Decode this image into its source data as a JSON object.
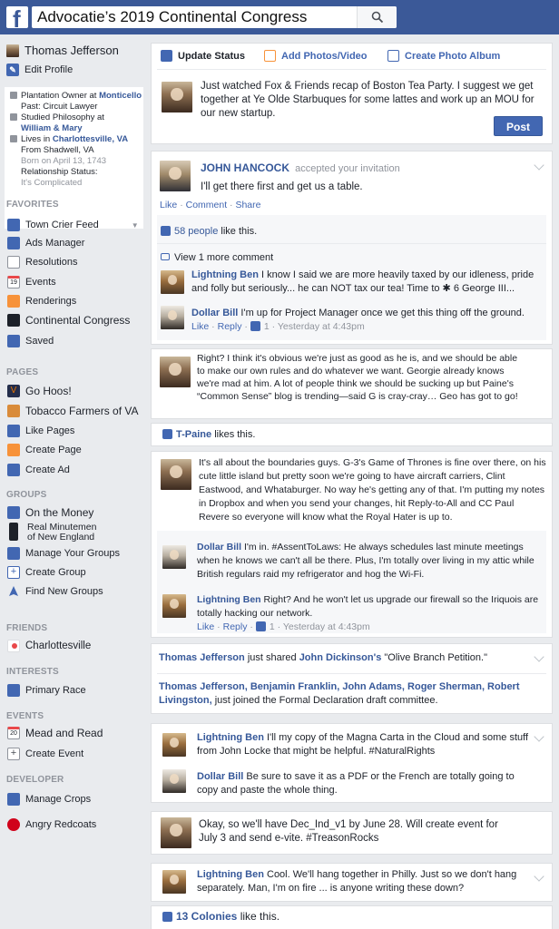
{
  "search": {
    "query": "Advocatie’s 2019 Continental Congress"
  },
  "profile": {
    "name": "Thomas Jefferson",
    "edit": "Edit Profile",
    "info": {
      "job": "Plantation Owner at",
      "job_place": "Monticello",
      "past": "Past: Circuit Lawyer",
      "studied": "Studied Philosophy at",
      "school": "William & Mary",
      "lives": "Lives in",
      "city": "Charlottesville, VA",
      "from": "From Shadwell, VA",
      "born": "Born on April 13, 1743",
      "rel": "Relationship Status:",
      "rel_val": "It's Complicated"
    }
  },
  "favorites": {
    "header": "FAVORITES",
    "items": [
      "Town Crier Feed",
      "Ads Manager",
      "Resolutions",
      "Events",
      "Renderings",
      "Continental Congress",
      "Saved"
    ],
    "events_day": "19"
  },
  "pages": {
    "header": "PAGES",
    "items": [
      "Go Hoos!",
      "Tobacco Farmers of VA",
      "Like Pages",
      "Create Page",
      "Create Ad"
    ]
  },
  "groups": {
    "header": "GROUPS",
    "items": [
      "On the Money",
      "Real Minutemen",
      "of New England",
      "Manage Your Groups",
      "Create Group",
      "Find New Groups"
    ]
  },
  "friends": {
    "header": "FRIENDS",
    "items": [
      "Charlottesville"
    ]
  },
  "interests": {
    "header": "INTERESTS",
    "items": [
      "Primary Race"
    ]
  },
  "events": {
    "header": "EVENTS",
    "items": [
      "Mead and Read",
      "Create Event"
    ],
    "day": "20"
  },
  "developer": {
    "header": "DEVELOPER",
    "items": [
      "Manage Crops",
      "Angry Redcoats"
    ]
  },
  "composer": {
    "tabs": [
      "Update Status",
      "Add Photos/Video",
      "Create Photo Album"
    ],
    "text": "Just watched Fox & Friends recap of Boston Tea Party. I suggest we get together at Ye Olde Starbuques for some lattes and work up an MOU for our new startup.",
    "post": "Post"
  },
  "post1": {
    "author": "JOHN HANCOCK",
    "action": "accepted your invitation",
    "text": "I'll get there first and get us a table.",
    "actions": [
      "Like",
      "·",
      "Comment",
      "·",
      "Share"
    ],
    "likes_count": "58 people",
    "likes_suffix": "like this.",
    "more_comments": "View 1 more comment",
    "c1_author": "Lightning Ben",
    "c1_text": "I know I said we are more heavily taxed by our idleness, pride and folly but seriously... he can NOT tax our tea!    Time to ✱ 6 George III...",
    "c2_author": "Dollar Bill",
    "c2_text": "I'm up for Project Manager once we get this thing off the ground.",
    "c2_meta_like": "Like",
    "c2_meta_reply": "Reply",
    "c2_meta_count": "1",
    "c2_meta_time": "Yesterday at 4:43pm"
  },
  "post2": {
    "text": "Right? I think it's obvious we're just as good as he is, and we should be able to make our own rules and do whatever we want. Georgie already knows we're mad at him. A lot of people think we should be sucking up but Paine's “Common Sense” blog is trending—said G is cray-cray… Geo has got to go!"
  },
  "post3": {
    "liker": "T-Paine",
    "suffix": "likes this."
  },
  "post4": {
    "text": "It's all about the boundaries guys. G-3's Game of Thrones is fine over there, on his cute little island but pretty soon we're going to have aircraft carriers, Clint Eastwood, and Whataburger. No way he's getting any of that. I'm putting my notes in Dropbox and when you send your changes, hit Reply-to-All and CC Paul Revere so everyone will know what the Royal Hater is up to.",
    "c1_author": "Dollar Bill",
    "c1_text": "I'm in. #AssentToLaws: He always schedules last minute meetings when he knows we can't all be there. Plus, I'm totally over living in my attic while British regulars raid my refrigerator and hog the Wi-Fi.",
    "c2_author": "Lightning Ben",
    "c2_text": "Right? And he won't let us upgrade our firewall so the Iriquois are totally hacking our network.",
    "meta_like": "Like",
    "meta_reply": "Reply",
    "meta_count": "1",
    "meta_time": "Yesterday at 4:43pm"
  },
  "post5": {
    "line1_name": "Thomas Jefferson",
    "line1_mid": "just shared",
    "line1_name2": "John Dickinson's",
    "line1_end": "\"Olive Branch Petition.\"",
    "line2_names": "Thomas Jefferson, Benjamin Franklin, John Adams, Roger Sherman, Robert Livingston,",
    "line2_end": "just joined the Formal Declaration draft committee."
  },
  "post6": {
    "c1_author": "Lightning Ben",
    "c1_text": "I'll my copy of the Magna Carta in the Cloud and some stuff from John Locke that might be helpful. #NaturalRights",
    "c2_author": "Dollar Bill",
    "c2_text": "Be sure to save it as a PDF or the French are totally going to copy and paste the whole thing."
  },
  "post7": {
    "text": "Okay, so we'll have Dec_Ind_v1 by June 28. Will create event for July 3 and send e-vite. #TreasonRocks"
  },
  "post8": {
    "author": "Lightning Ben",
    "text": "Cool. We'll hang together in Philly. Just so we don't hang separately.    Man, I'm on fire ... is anyone writing these down?"
  },
  "post9": {
    "count": "13 Colonies",
    "suffix": "like this."
  },
  "colors": {
    "brand": "#3b5998",
    "link": "#365899",
    "bg": "#e9ebee"
  }
}
